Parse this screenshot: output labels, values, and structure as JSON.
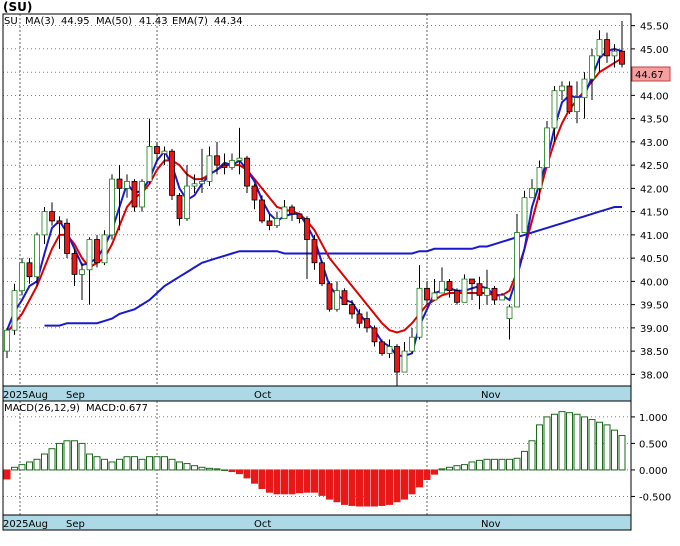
{
  "chart_data": {
    "type": "candlestick",
    "symbol": "(SU)",
    "legend": {
      "ticker": "SU",
      "ma3_label": "MA(3)",
      "ma3_value": "44.95",
      "ma50_label": "MA(50)",
      "ma50_value": "41.43",
      "ema7_label": "EMA(7)",
      "ema7_value": "44.34"
    },
    "last_price_label": "44.67",
    "price_axis": {
      "min": 37.75,
      "max": 45.75,
      "ticks": [
        "38.00",
        "38.50",
        "39.00",
        "39.50",
        "40.00",
        "40.50",
        "41.00",
        "41.50",
        "42.00",
        "42.50",
        "43.00",
        "43.50",
        "44.00",
        "44.50",
        "45.00",
        "45.50"
      ]
    },
    "x_labels": [
      "2025Aug",
      "Sep",
      "Oct",
      "Nov"
    ],
    "candles": [
      [
        38.5,
        38.95,
        38.35,
        39.0
      ],
      [
        38.95,
        39.8,
        38.85,
        39.95
      ],
      [
        39.8,
        40.4,
        39.7,
        40.5
      ],
      [
        40.4,
        40.1,
        39.95,
        40.5
      ],
      [
        40.1,
        41.0,
        39.9,
        41.05
      ],
      [
        41.0,
        41.5,
        40.8,
        41.6
      ],
      [
        41.5,
        41.3,
        41.2,
        41.7
      ],
      [
        41.3,
        41.25,
        40.7,
        41.4
      ],
      [
        41.25,
        40.6,
        40.5,
        41.35
      ],
      [
        40.6,
        40.15,
        39.9,
        40.7
      ],
      [
        40.15,
        40.25,
        39.6,
        40.4
      ],
      [
        40.25,
        40.9,
        39.5,
        40.95
      ],
      [
        40.9,
        40.4,
        40.3,
        41.0
      ],
      [
        40.4,
        41.0,
        40.35,
        41.1
      ],
      [
        41.0,
        42.2,
        40.9,
        42.3
      ],
      [
        42.2,
        42.0,
        41.1,
        42.5
      ],
      [
        42.0,
        42.15,
        41.8,
        42.3
      ],
      [
        42.15,
        41.6,
        41.5,
        42.2
      ],
      [
        41.6,
        42.15,
        41.5,
        42.2
      ],
      [
        42.15,
        42.9,
        42.1,
        43.5
      ],
      [
        42.9,
        42.75,
        42.6,
        43.0
      ],
      [
        42.75,
        42.8,
        42.5,
        42.9
      ],
      [
        42.8,
        41.85,
        41.75,
        42.85
      ],
      [
        41.85,
        41.35,
        41.2,
        41.9
      ],
      [
        41.35,
        42.05,
        41.3,
        42.5
      ],
      [
        42.05,
        42.1,
        41.9,
        42.3
      ],
      [
        42.1,
        42.15,
        41.9,
        42.85
      ],
      [
        42.15,
        42.7,
        42.05,
        42.9
      ],
      [
        42.7,
        42.5,
        42.3,
        43.0
      ],
      [
        42.5,
        42.45,
        42.3,
        42.75
      ],
      [
        42.45,
        42.6,
        42.4,
        42.75
      ],
      [
        42.6,
        42.65,
        42.3,
        43.3
      ],
      [
        42.65,
        42.05,
        41.9,
        42.7
      ],
      [
        42.05,
        41.75,
        41.55,
        42.1
      ],
      [
        41.75,
        41.3,
        41.25,
        41.85
      ],
      [
        41.3,
        41.2,
        41.1,
        41.45
      ],
      [
        41.2,
        41.35,
        41.15,
        41.5
      ],
      [
        41.35,
        41.6,
        41.4,
        41.75
      ],
      [
        41.6,
        41.45,
        41.3,
        41.65
      ],
      [
        41.45,
        41.35,
        41.25,
        41.45
      ],
      [
        41.35,
        40.9,
        40.05,
        41.4
      ],
      [
        40.9,
        40.4,
        40.25,
        41.0
      ],
      [
        40.4,
        39.95,
        39.9,
        40.45
      ],
      [
        39.95,
        39.4,
        39.35,
        40.0
      ],
      [
        39.4,
        39.8,
        39.35,
        40.0
      ],
      [
        39.8,
        39.5,
        39.5,
        39.85
      ],
      [
        39.5,
        39.3,
        39.2,
        39.6
      ],
      [
        39.3,
        39.1,
        39.0,
        39.4
      ],
      [
        39.2,
        39.0,
        38.9,
        39.35
      ],
      [
        39.0,
        38.7,
        38.6,
        39.05
      ],
      [
        38.7,
        38.45,
        38.4,
        38.75
      ],
      [
        38.45,
        38.6,
        38.35,
        38.75
      ],
      [
        38.6,
        38.05,
        37.75,
        38.65
      ],
      [
        38.05,
        38.5,
        38.3,
        38.7
      ],
      [
        38.5,
        38.8,
        38.45,
        39.0
      ],
      [
        38.8,
        39.85,
        38.75,
        40.35
      ],
      [
        39.85,
        39.6,
        39.5,
        40.0
      ],
      [
        39.6,
        39.75,
        39.6,
        40.05
      ],
      [
        39.75,
        40.0,
        39.8,
        40.3
      ],
      [
        40.0,
        39.8,
        39.65,
        40.05
      ],
      [
        39.8,
        39.55,
        39.5,
        39.85
      ],
      [
        39.55,
        40.05,
        39.6,
        40.15
      ],
      [
        40.05,
        39.95,
        39.6,
        40.0
      ],
      [
        39.95,
        39.7,
        39.4,
        40.1
      ],
      [
        39.7,
        39.85,
        39.5,
        40.25
      ],
      [
        39.85,
        39.6,
        39.5,
        39.9
      ],
      [
        39.6,
        39.7,
        39.6,
        39.75
      ],
      [
        39.2,
        39.45,
        38.75,
        39.5
      ],
      [
        39.45,
        41.05,
        40.6,
        41.45
      ],
      [
        41.05,
        41.8,
        41.1,
        41.95
      ],
      [
        41.8,
        42.0,
        41.8,
        42.2
      ],
      [
        42.0,
        42.45,
        41.75,
        42.6
      ],
      [
        42.45,
        43.3,
        42.5,
        43.45
      ],
      [
        43.3,
        44.1,
        43.0,
        44.2
      ],
      [
        44.1,
        44.2,
        43.9,
        44.3
      ],
      [
        44.2,
        43.65,
        43.6,
        44.3
      ],
      [
        43.65,
        43.95,
        43.4,
        44.3
      ],
      [
        43.95,
        44.35,
        43.5,
        44.5
      ],
      [
        44.35,
        44.85,
        43.9,
        45.0
      ],
      [
        44.85,
        45.2,
        44.5,
        45.4
      ],
      [
        45.2,
        44.85,
        44.7,
        45.35
      ],
      [
        44.85,
        44.95,
        44.6,
        45.1
      ],
      [
        44.95,
        44.67,
        44.6,
        45.6
      ]
    ],
    "ma3": [
      38.95,
      39.35,
      39.6,
      39.9,
      40.0,
      40.6,
      41.15,
      41.3,
      41.05,
      40.7,
      40.35,
      40.4,
      40.5,
      40.75,
      41.1,
      41.6,
      42.1,
      41.9,
      41.95,
      42.2,
      42.6,
      42.8,
      42.5,
      42.0,
      41.75,
      41.85,
      42.1,
      42.3,
      42.4,
      42.55,
      42.5,
      42.6,
      42.4,
      42.15,
      41.75,
      41.45,
      41.3,
      41.4,
      41.45,
      41.45,
      41.2,
      40.9,
      40.4,
      39.9,
      39.7,
      39.6,
      39.55,
      39.3,
      39.1,
      38.95,
      38.7,
      38.6,
      38.4,
      38.4,
      38.45,
      39.05,
      39.4,
      39.75,
      39.8,
      39.85,
      39.8,
      39.8,
      39.85,
      39.9,
      39.85,
      39.7,
      39.7,
      39.6,
      40.1,
      40.7,
      41.6,
      42.1,
      42.6,
      43.3,
      43.85,
      44.0,
      43.95,
      44.0,
      44.4,
      44.8,
      44.95,
      45.0,
      44.95
    ],
    "ema7": [
      null,
      null,
      null,
      null,
      null,
      39.05,
      39.05,
      39.05,
      39.1,
      39.1,
      39.1,
      39.1,
      39.1,
      39.15,
      39.2,
      39.3,
      39.35,
      39.4,
      39.5,
      39.6,
      39.75,
      39.9,
      40.0,
      40.1,
      40.2,
      40.3,
      40.4,
      40.45,
      40.5,
      40.55,
      40.6,
      40.65,
      40.65,
      40.65,
      40.65,
      40.65,
      40.65,
      40.6,
      40.6,
      40.6,
      40.6,
      40.6,
      40.6,
      40.6,
      40.6,
      40.6,
      40.6,
      40.6,
      40.6,
      40.6,
      40.6,
      40.6,
      40.6,
      40.6,
      40.6,
      40.65,
      40.65,
      40.7,
      40.7,
      40.7,
      40.7,
      40.7,
      40.7,
      40.75,
      40.75,
      40.8,
      40.85,
      40.9,
      40.95,
      41.0,
      41.05,
      41.1,
      41.15,
      41.2,
      41.25,
      41.3,
      41.35,
      41.4,
      41.45,
      41.5,
      41.55,
      41.6,
      41.6
    ],
    "ma50": [
      38.9,
      39.1,
      39.3,
      39.6,
      39.9,
      40.3,
      40.7,
      41.0,
      41.0,
      40.8,
      40.5,
      40.3,
      40.4,
      40.5,
      40.8,
      41.2,
      41.6,
      41.8,
      41.9,
      42.1,
      42.4,
      42.6,
      42.6,
      42.5,
      42.3,
      42.2,
      42.2,
      42.3,
      42.4,
      42.5,
      42.5,
      42.5,
      42.4,
      42.2,
      42.0,
      41.8,
      41.6,
      41.55,
      41.5,
      41.45,
      41.3,
      41.1,
      40.8,
      40.5,
      40.3,
      40.1,
      39.9,
      39.7,
      39.5,
      39.3,
      39.1,
      38.95,
      38.9,
      38.95,
      39.1,
      39.3,
      39.5,
      39.6,
      39.7,
      39.75,
      39.75,
      39.75,
      39.75,
      39.75,
      39.75,
      39.7,
      39.7,
      39.8,
      40.2,
      40.7,
      41.3,
      41.9,
      42.5,
      43.0,
      43.4,
      43.7,
      43.9,
      44.1,
      44.3,
      44.5,
      44.6,
      44.7,
      44.8
    ],
    "macd_axis": {
      "min": -0.85,
      "max": 1.3,
      "ticks": [
        "1.000",
        "0.500",
        "0.000",
        "-0.500"
      ]
    },
    "macd_legend": {
      "params": "MACD(26,12,9)",
      "value_label": "MACD:0.677"
    },
    "macd_hist": [
      -0.17,
      0.05,
      0.1,
      0.15,
      0.2,
      0.3,
      0.4,
      0.5,
      0.55,
      0.55,
      0.5,
      0.3,
      0.25,
      0.2,
      0.15,
      0.2,
      0.25,
      0.25,
      0.2,
      0.25,
      0.25,
      0.25,
      0.2,
      0.15,
      0.12,
      0.08,
      0.05,
      0.03,
      0.02,
      0.0,
      -0.03,
      -0.07,
      -0.15,
      -0.25,
      -0.35,
      -0.42,
      -0.45,
      -0.45,
      -0.45,
      -0.43,
      -0.42,
      -0.42,
      -0.48,
      -0.55,
      -0.6,
      -0.65,
      -0.67,
      -0.68,
      -0.68,
      -0.68,
      -0.67,
      -0.65,
      -0.6,
      -0.55,
      -0.45,
      -0.32,
      -0.18,
      -0.08,
      0.02,
      0.05,
      0.08,
      0.1,
      0.15,
      0.18,
      0.2,
      0.2,
      0.2,
      0.2,
      0.22,
      0.35,
      0.55,
      0.85,
      1.0,
      1.05,
      1.1,
      1.08,
      1.05,
      1.0,
      0.95,
      0.9,
      0.85,
      0.75,
      0.65
    ]
  }
}
